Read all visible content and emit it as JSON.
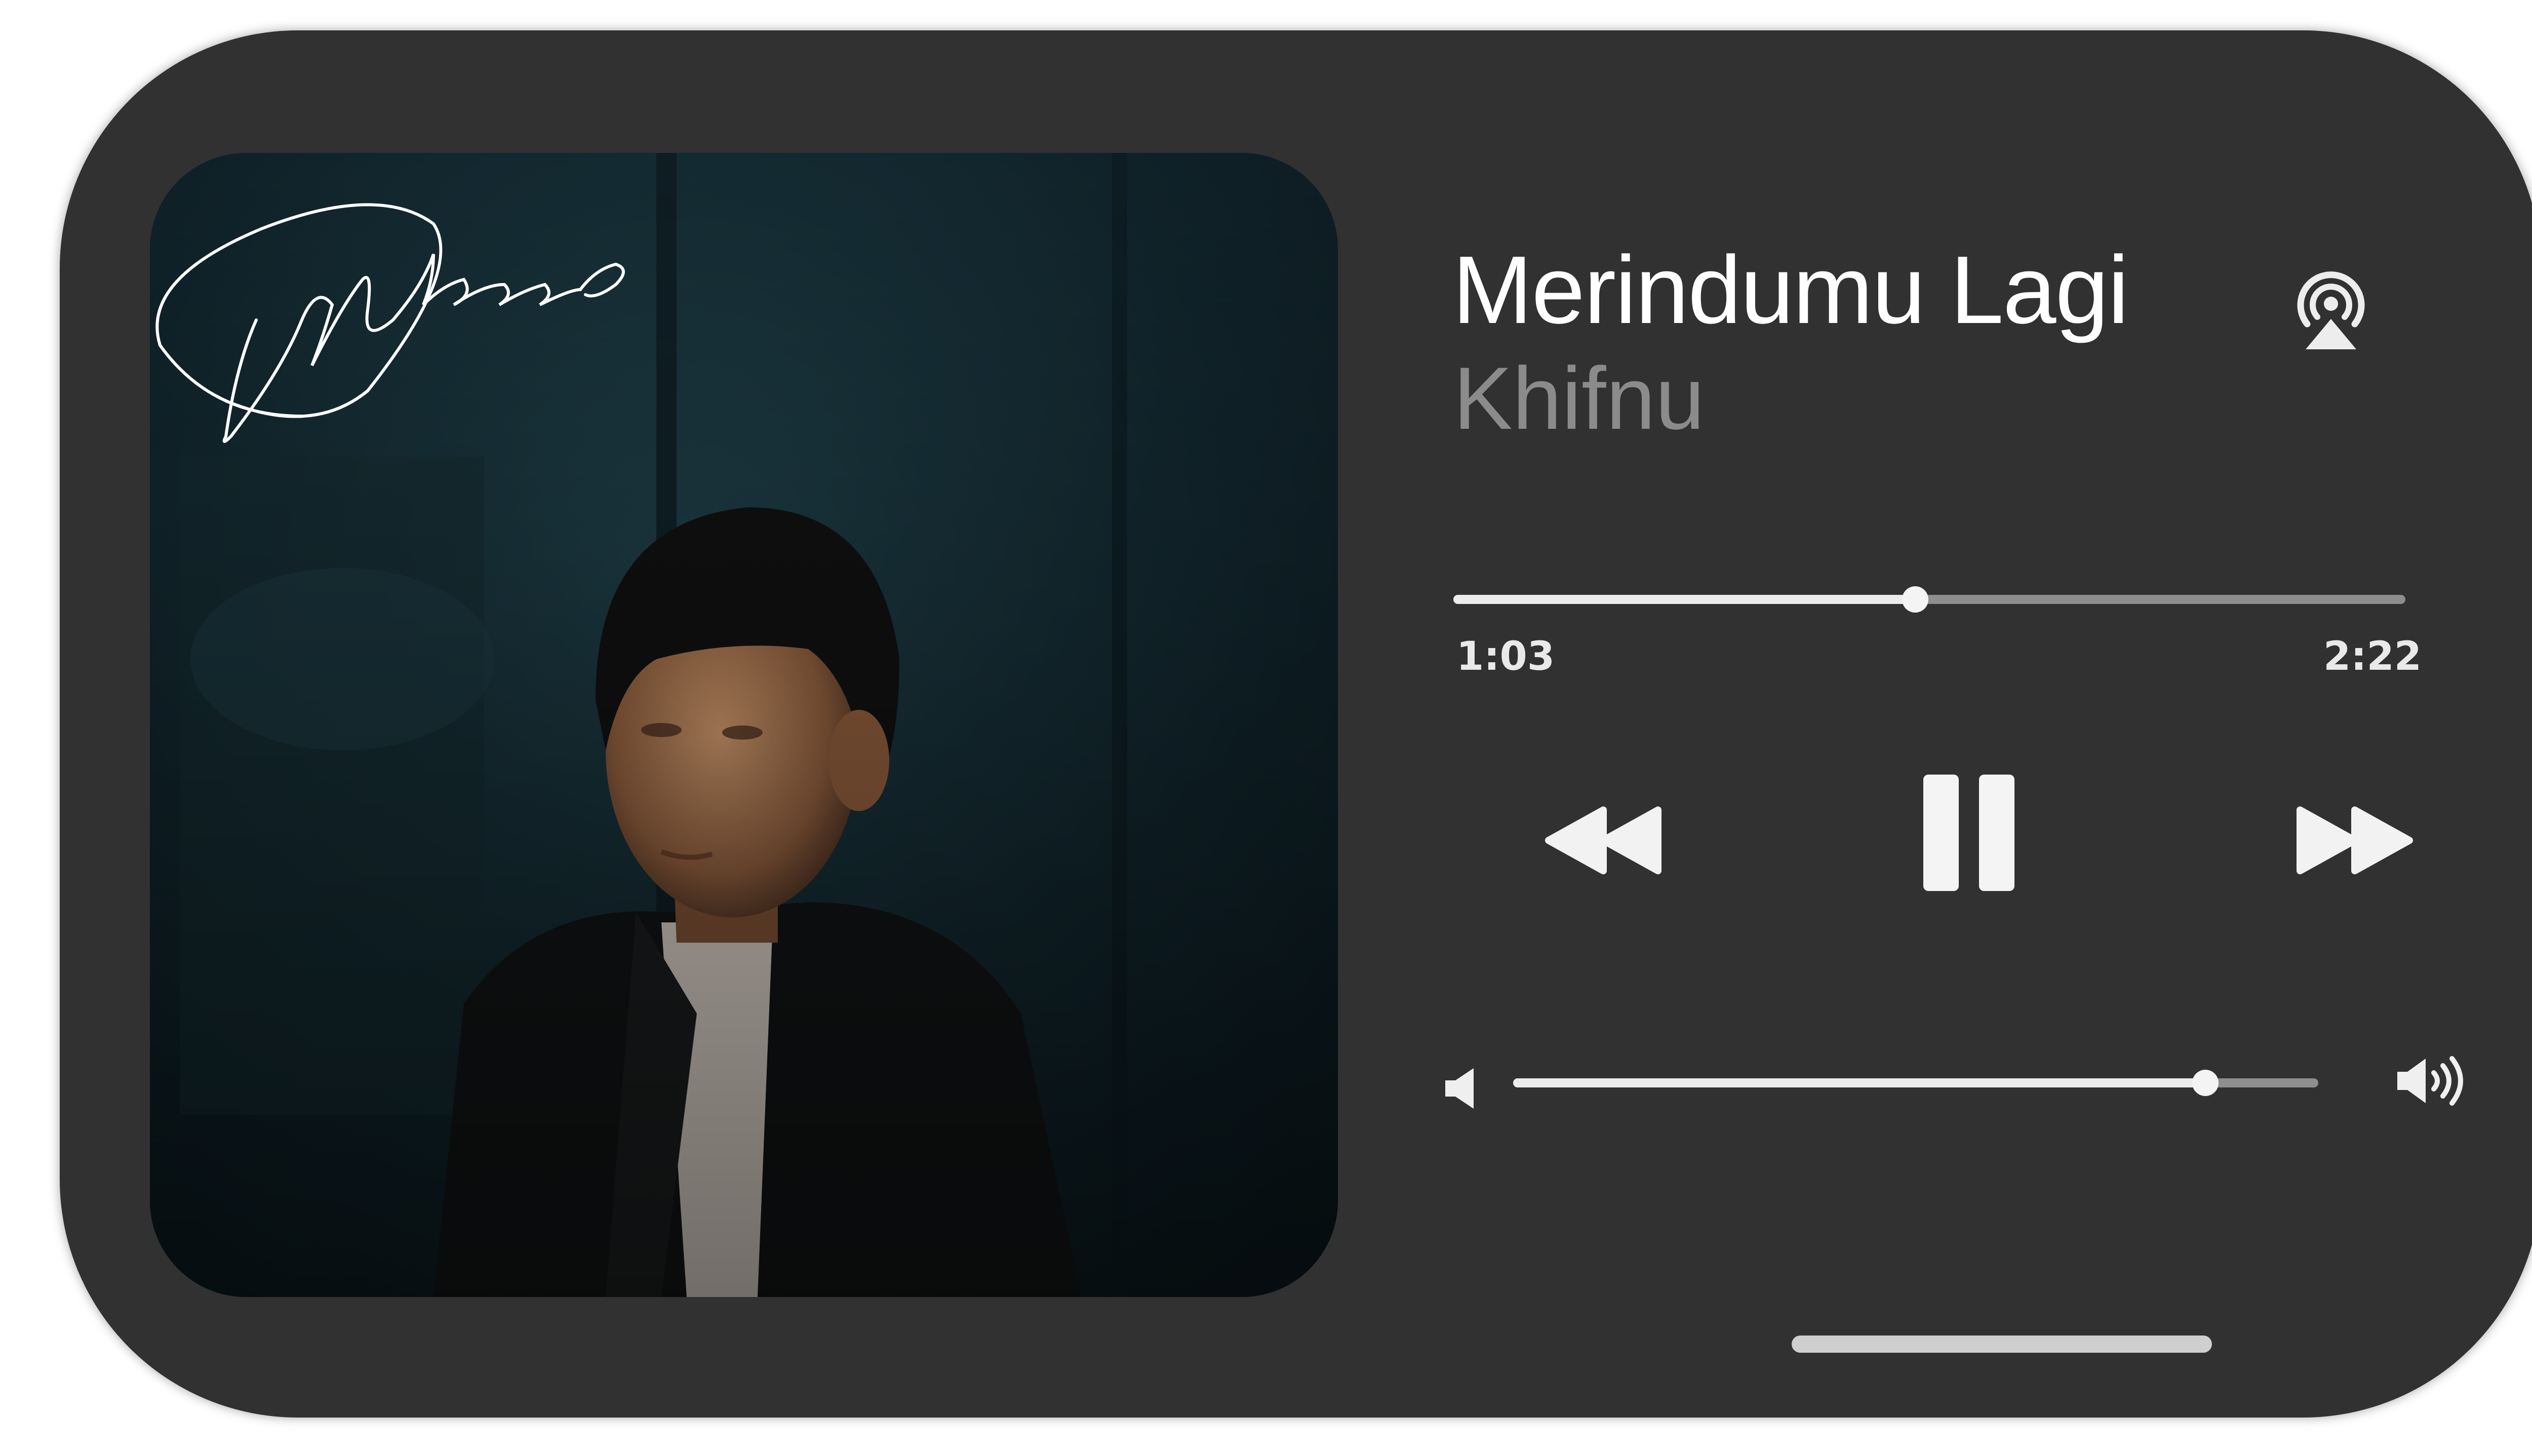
{
  "now_playing": {
    "title": "Merindumu Lagi",
    "artist": "Khifnu",
    "artwork_signature": "Dylphiiee"
  },
  "progress": {
    "elapsed": "1:03",
    "total": "2:22",
    "fraction": 0.485
  },
  "volume": {
    "fraction": 0.86
  },
  "controls": {
    "rewind_icon": "rewind-icon",
    "pause_icon": "pause-icon",
    "forward_icon": "fast-forward-icon",
    "airplay_icon": "airplay-icon",
    "volume_min_icon": "speaker-low-icon",
    "volume_max_icon": "speaker-high-icon"
  },
  "colors": {
    "card_background": "#313131",
    "title": "#ffffff",
    "artist": "#8b8b8b",
    "track_filled": "#ececec",
    "track_remaining": "#8e8e8e"
  }
}
